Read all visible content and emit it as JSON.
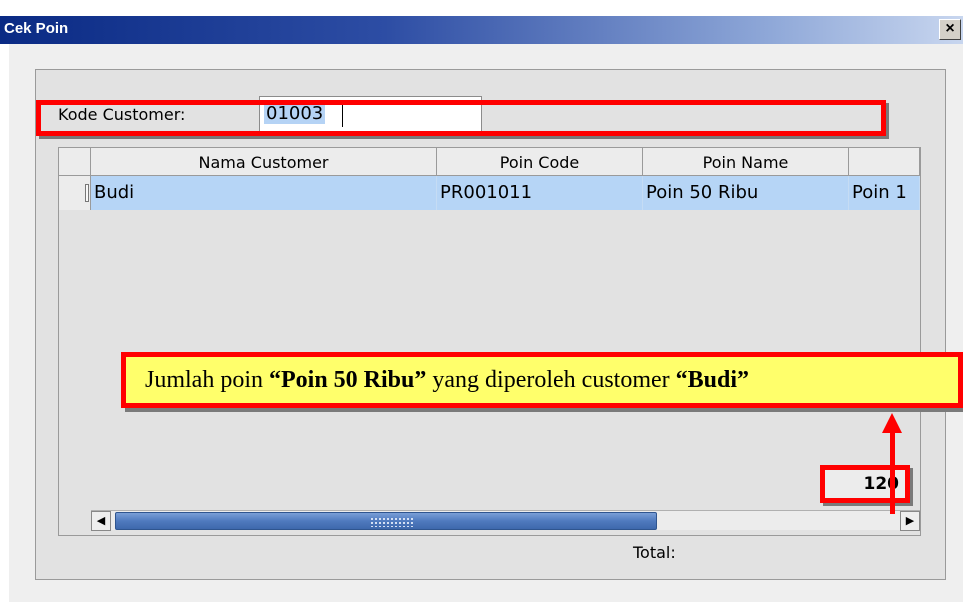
{
  "window": {
    "title": "Cek Poin",
    "close_symbol": "×"
  },
  "form": {
    "kode_label": "Kode Customer:",
    "kode_value": "01003"
  },
  "table": {
    "headers": [
      "Nama Customer",
      "Poin Code",
      "Poin Name",
      ""
    ],
    "rows": [
      {
        "nama_customer": "Budi",
        "poin_code": "PR001011",
        "poin_name": "Poin 50 Ribu",
        "extra": "Poin 1"
      }
    ]
  },
  "scrollbar": {
    "left_arrow": "◀",
    "right_arrow": "▶"
  },
  "total": {
    "label": "Total:",
    "value": "120"
  },
  "annotation": {
    "prefix": "Jumlah poin ",
    "poin_name": "“Poin 50 Ribu”",
    "middle": " yang diperoleh customer ",
    "customer": "“Budi”"
  },
  "colors": {
    "selection": "#b6d5f6",
    "highlight": "#ff0000",
    "callout_bg": "#ffff6b",
    "titlebar_start": "#0a2a84"
  }
}
